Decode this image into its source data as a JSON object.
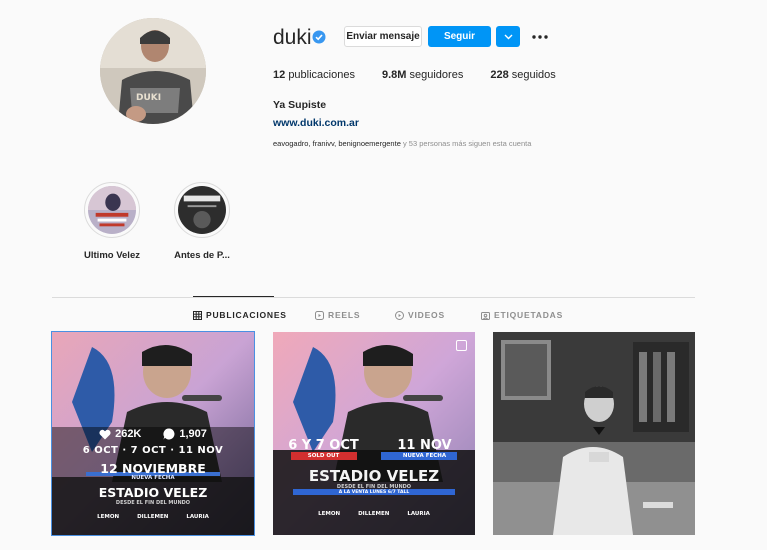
{
  "profile": {
    "username": "duki",
    "verified": true,
    "message_button": "Enviar mensaje",
    "follow_button": "Seguir",
    "stats": [
      {
        "value": "12",
        "label": "publicaciones"
      },
      {
        "value": "9.8M",
        "label": "seguidores"
      },
      {
        "value": "228",
        "label": "seguidos"
      }
    ],
    "full_name": "Ya Supiste",
    "website": "www.duki.com.ar",
    "followed_by_names": "eavogadro, franivv, benignoemergente",
    "followed_by_rest": " y 53 personas más siguen esta cuenta"
  },
  "highlights": [
    {
      "label": "Ultimo Velez"
    },
    {
      "label": "Antes de P..."
    }
  ],
  "tabs": [
    {
      "label": "PUBLICACIONES",
      "icon": "grid-icon",
      "active": true
    },
    {
      "label": "REELS",
      "icon": "reels-icon",
      "active": false
    },
    {
      "label": "VIDEOS",
      "icon": "video-icon",
      "active": false
    },
    {
      "label": "ETIQUETADAS",
      "icon": "tag-icon",
      "active": false
    }
  ],
  "posts": [
    {
      "likes": "262K",
      "comments": "1,907",
      "dates": "6 OCT · 7 OCT · 11 NOV",
      "date_big": "12 NOVIEMBRE",
      "new_date": "NUEVA FECHA",
      "venue": "ESTADIO VELEZ",
      "subtitle": "DESDE EL FIN DEL MUNDO",
      "sponsors": [
        "LEMON",
        "DILLEMEN",
        "LAURIA"
      ]
    },
    {
      "date_left": "6 Y 7 OCT",
      "sold_out": "SOLD OUT",
      "date_right": "11 NOV",
      "new_date": "NUEVA FECHA",
      "venue": "ESTADIO VELEZ",
      "subtitle": "DESDE EL FIN DEL MUNDO",
      "sale": "A LA VENTA LUNES 6/7 TALL",
      "sponsors": [
        "LEMON",
        "DILLEMEN",
        "LAURIA"
      ]
    },
    {
      "type": "photo"
    }
  ],
  "colors": {
    "accent": "#0095f6",
    "link": "#00376b",
    "muted": "#8e8e8e",
    "border": "#dbdbdb"
  }
}
